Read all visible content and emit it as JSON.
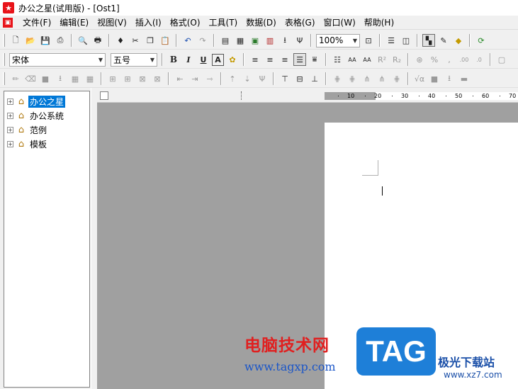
{
  "window": {
    "title": "办公之星(试用版) - [Ost1]",
    "app_icon": "star-app-icon",
    "doc_icon": "document-icon"
  },
  "menu": {
    "items": [
      {
        "label": "文件(F)"
      },
      {
        "label": "编辑(E)"
      },
      {
        "label": "视图(V)"
      },
      {
        "label": "插入(I)"
      },
      {
        "label": "格式(O)"
      },
      {
        "label": "工具(T)"
      },
      {
        "label": "数据(D)"
      },
      {
        "label": "表格(G)"
      },
      {
        "label": "窗口(W)"
      },
      {
        "label": "帮助(H)"
      }
    ]
  },
  "toolbar_standard": {
    "zoom": "100%",
    "buttons": [
      "new-icon",
      "open-icon",
      "save-icon",
      "print-preview-icon",
      "print-icon",
      "find-icon",
      "cut-icon",
      "copy-icon",
      "paste-icon",
      "undo-icon",
      "redo-icon",
      "page-setup-icon",
      "table-icon",
      "image-icon",
      "chart-icon",
      "insert-field-icon",
      "symbol-icon",
      "zoom-fit-icon",
      "layout-horizontal-icon",
      "layout-vertical-icon",
      "panel-toggle-icon",
      "edit-icon",
      "highlight-icon",
      "refresh-icon"
    ]
  },
  "toolbar_format": {
    "font": "宋体",
    "size": "五号",
    "bold": "B",
    "italic": "I",
    "underline": "U",
    "char_box": "A",
    "buttons": [
      "char-border-icon",
      "font-color-icon",
      "align-left-icon",
      "align-center-icon",
      "align-right-icon",
      "justify-icon",
      "distribute-icon",
      "line-spacing-icon",
      "char-spacing-increase-icon",
      "char-spacing-decrease-icon",
      "superscript-icon",
      "subscript-icon",
      "currency-icon",
      "percent-icon",
      "comma-icon",
      "decimal-increase-icon",
      "decimal-decrease-icon",
      "lock-icon"
    ]
  },
  "toolbar_table": {
    "buttons": [
      "pencil-icon",
      "eraser-icon",
      "cell-shade-icon",
      "merge-icon",
      "split-icon",
      "insert-row-icon",
      "insert-col-icon",
      "delete-row-icon",
      "delete-col-icon",
      "align-top-icon",
      "align-middle-icon",
      "align-bottom-icon",
      "distribute-rows-icon",
      "distribute-cols-icon",
      "formula-icon",
      "fill-color-icon",
      "sort-icon"
    ],
    "sqrt_glyph": "√α"
  },
  "tree": {
    "items": [
      {
        "label": "办公之星",
        "selected": true
      },
      {
        "label": "办公系统",
        "selected": false
      },
      {
        "label": "范例",
        "selected": false
      },
      {
        "label": "模板",
        "selected": false
      }
    ]
  },
  "ruler": {
    "labels": [
      "10",
      "20",
      "30",
      "40",
      "50",
      "60",
      "70"
    ]
  },
  "watermark": {
    "site_cn": "电脑技术网",
    "site_url": "www.tagxp.com",
    "tag": "TAG",
    "site2_cn": "极光下载站",
    "site2_url": "www.xz7.com"
  }
}
